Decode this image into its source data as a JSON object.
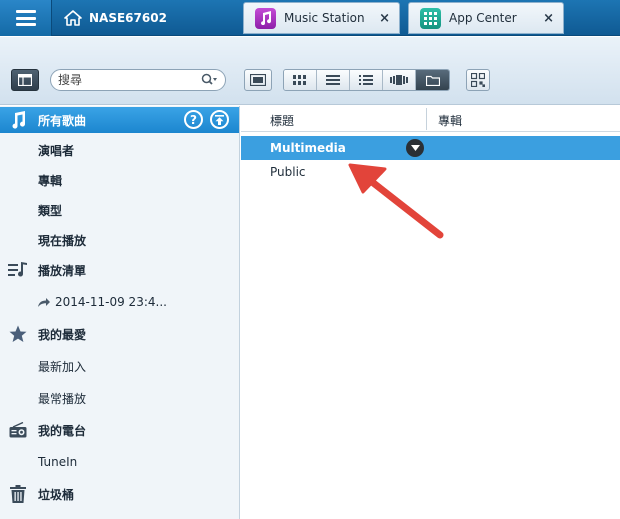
{
  "topbar": {
    "server_name": "NASE67602",
    "tabs": [
      {
        "label": "Music Station",
        "close": "×"
      },
      {
        "label": "App Center",
        "close": "×"
      }
    ]
  },
  "toolbar": {
    "search_placeholder": "搜尋"
  },
  "sidebar": {
    "all_songs": "所有歌曲",
    "help": "?",
    "artists": "演唱者",
    "albums": "專輯",
    "genres": "類型",
    "now_playing": "現在播放",
    "playlists": "播放清單",
    "playlist_entry": "2014-11-09 23:4...",
    "favorites": "我的最愛",
    "recently_added": "最新加入",
    "most_played": "最常播放",
    "radio": "我的電台",
    "tunein": "TuneIn",
    "trash": "垃圾桶"
  },
  "content": {
    "columns": {
      "title": "標題",
      "album": "專輯"
    },
    "rows": [
      {
        "title": "Multimedia"
      },
      {
        "title": "Public"
      }
    ]
  },
  "colors": {
    "accent": "#1c86cf",
    "topbar": "#0f5a93",
    "selection": "#3b9fe0",
    "annotation_arrow": "#e2443a"
  }
}
